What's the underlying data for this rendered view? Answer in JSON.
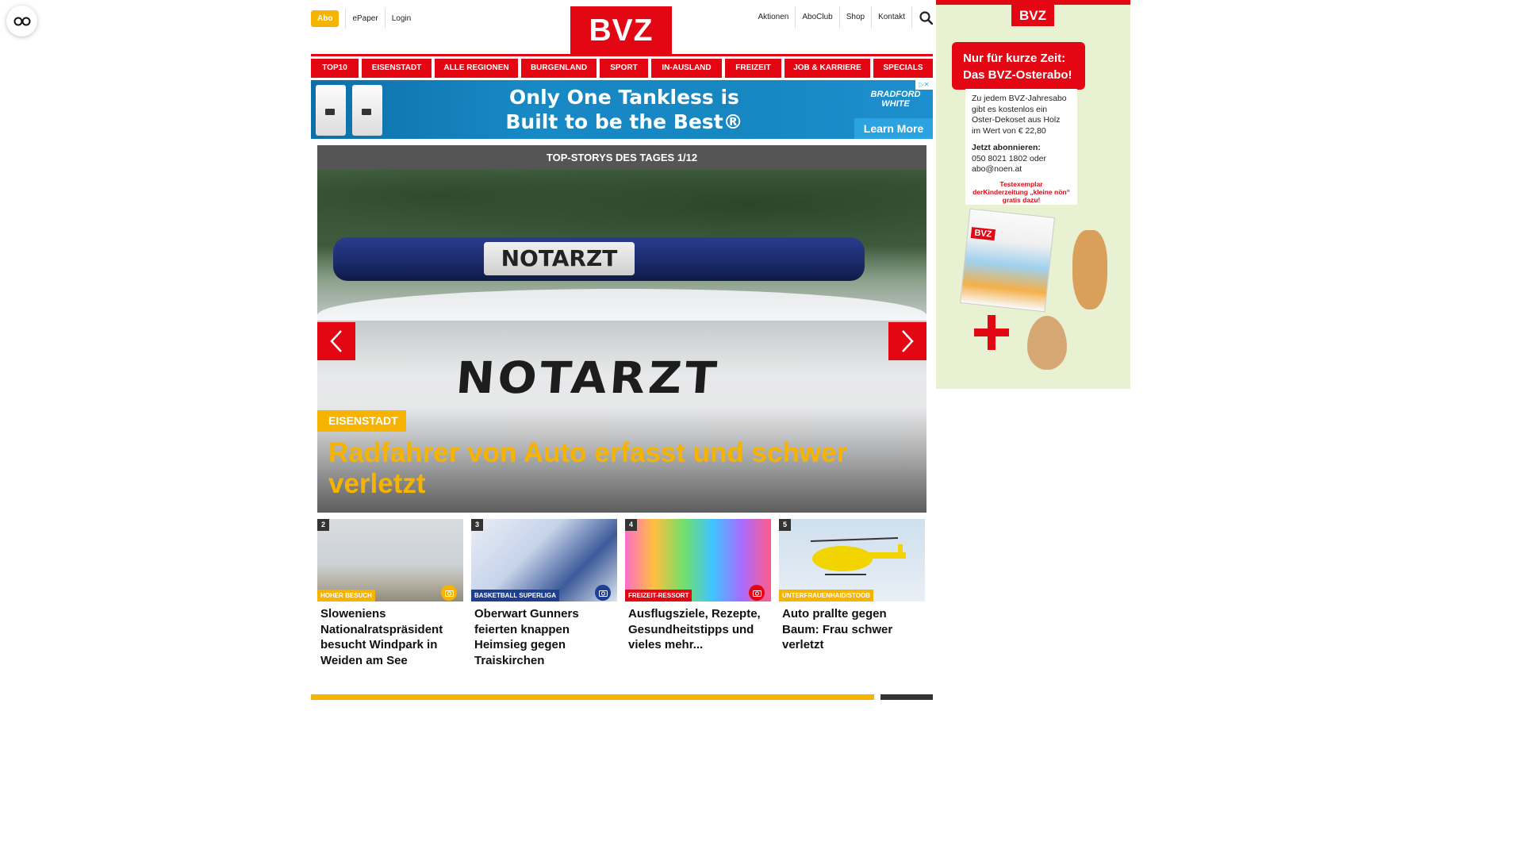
{
  "header": {
    "abo": "Abo",
    "left_links": [
      "ePaper",
      "Login"
    ],
    "logo": "BVZ",
    "right_links": [
      "Aktionen",
      "AboClub",
      "Shop",
      "Kontakt"
    ]
  },
  "nav": [
    {
      "label": "TOP10"
    },
    {
      "label": "EISENSTADT"
    },
    {
      "label": "ALLE REGIONEN"
    },
    {
      "label": "BURGENLAND"
    },
    {
      "label": "SPORT"
    },
    {
      "label": "IN-AUSLAND"
    },
    {
      "label": "FREIZEIT"
    },
    {
      "label": "JOB & KARRIERE"
    },
    {
      "label": "SPECIALS"
    }
  ],
  "banner": {
    "line1": "Only One Tankless is",
    "line2": "Built to be the Best®",
    "brand": "BRADFORD WHITE",
    "cta": "Learn More"
  },
  "hero": {
    "header": "TOP-STORYS DES TAGES 1/12",
    "lightbar_text": "NOTARZT",
    "vehicle_text": "NOTARZT",
    "category": "EISENSTADT",
    "title": "Radfahrer von Auto erfasst und schwer verletzt"
  },
  "teasers": [
    {
      "num": "2",
      "category": "HOHER BESUCH",
      "cat_color": "#f6b300",
      "title": "Sloweniens Nationalratspräsident besucht Windpark in Weiden am See",
      "icon": "camera-icon"
    },
    {
      "num": "3",
      "category": "BASKETBALL SUPERLIGA",
      "cat_color": "#1e3f8f",
      "title": "Oberwart Gunners feierten knappen Heimsieg gegen Traiskirchen",
      "icon": "camera-icon"
    },
    {
      "num": "4",
      "category": "FREIZEIT-RESSORT",
      "cat_color": "#e30613",
      "title": "Ausflugsziele, Rezepte, Gesundheitstipps und vieles mehr...",
      "icon": "camera-icon"
    },
    {
      "num": "5",
      "category": "UNTERFRAUENHAID/STOOB",
      "cat_color": "#f6b300",
      "title": "Auto prallte gegen Baum: Frau schwer verletzt",
      "icon": ""
    }
  ],
  "side_ad": {
    "logo": "BVZ",
    "offer_line1": "Nur für kurze Zeit:",
    "offer_line2": "Das BVZ-Osterabo!",
    "body1": "Zu jedem BVZ-Jahresabo gibt es kostenlos ein Oster-Dekoset aus Holz im Wert von € 22,80",
    "sub_title": "Jetzt abonnieren:",
    "contact": "050 8021 1802 oder abo@noen.at",
    "kids": "Testexemplar derKinderzeitung „kleine nön“ gratis dazu!",
    "mag_logo": "BVZ"
  },
  "colors": {
    "brand_red": "#e30613",
    "accent_yellow": "#f6b300",
    "dark_gray": "#555555"
  }
}
